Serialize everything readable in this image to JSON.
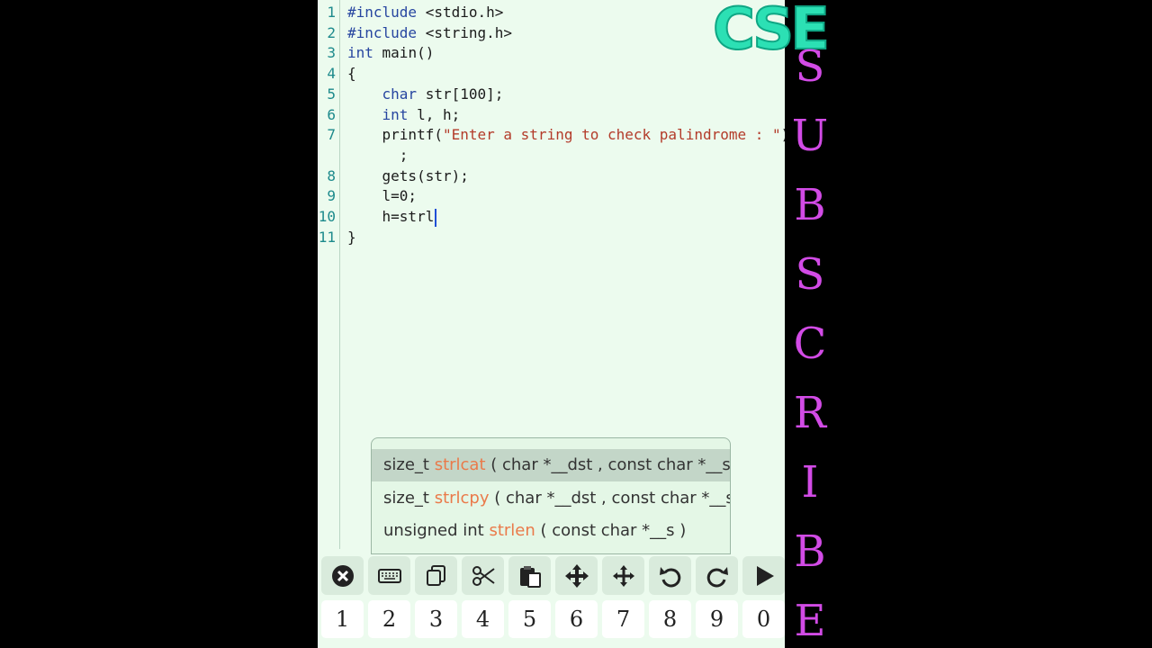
{
  "editor": {
    "line_numbers": [
      "1",
      "2",
      "3",
      "4",
      "5",
      "6",
      "7",
      "",
      "8",
      "9",
      "10",
      "11"
    ],
    "lines": [
      [
        {
          "t": "#include",
          "c": "kw"
        },
        {
          "t": " <stdio.h>",
          "c": ""
        }
      ],
      [
        {
          "t": "#include",
          "c": "kw"
        },
        {
          "t": " <string.h>",
          "c": ""
        }
      ],
      [
        {
          "t": "int",
          "c": "kw"
        },
        {
          "t": " main()",
          "c": ""
        }
      ],
      [
        {
          "t": "{",
          "c": ""
        }
      ],
      [
        {
          "t": "    ",
          "c": ""
        },
        {
          "t": "char",
          "c": "kw"
        },
        {
          "t": " str[100];",
          "c": ""
        }
      ],
      [
        {
          "t": "    ",
          "c": ""
        },
        {
          "t": "int",
          "c": "kw"
        },
        {
          "t": " l, h;",
          "c": ""
        }
      ],
      [
        {
          "t": "    printf(",
          "c": ""
        },
        {
          "t": "\"Enter a string to check palindrome : \"",
          "c": "str"
        },
        {
          "t": ")",
          "c": ""
        }
      ],
      [
        {
          "t": "      ;",
          "c": ""
        }
      ],
      [
        {
          "t": "    gets(str);",
          "c": ""
        }
      ],
      [
        {
          "t": "    l=0;",
          "c": ""
        }
      ],
      [
        {
          "t": "    h=strl",
          "c": ""
        }
      ],
      [
        {
          "t": "}",
          "c": ""
        }
      ]
    ]
  },
  "autocomplete": [
    {
      "pre": "size_t ",
      "match": "strl",
      "rest": "cat",
      "sig": " ( char *__dst ,  const char *__s"
    },
    {
      "pre": "size_t ",
      "match": "strl",
      "rest": "cpy",
      "sig": " ( char *__dst ,  const char *__s"
    },
    {
      "pre": "unsigned int ",
      "match": "strl",
      "rest": "en",
      "sig": " ( const char *__s )"
    }
  ],
  "toolbar": [
    "close-icon",
    "keyboard-icon",
    "copy-icon",
    "cut-icon",
    "paste-icon",
    "move-cursor-icon",
    "select-move-icon",
    "undo-icon",
    "redo-icon",
    "run-icon"
  ],
  "numbers": [
    "1",
    "2",
    "3",
    "4",
    "5",
    "6",
    "7",
    "8",
    "9",
    "0"
  ],
  "overlay": {
    "logo": "CSE",
    "subscribe": [
      "S",
      "U",
      "B",
      "S",
      "C",
      "R",
      "I",
      "B",
      "E"
    ]
  }
}
